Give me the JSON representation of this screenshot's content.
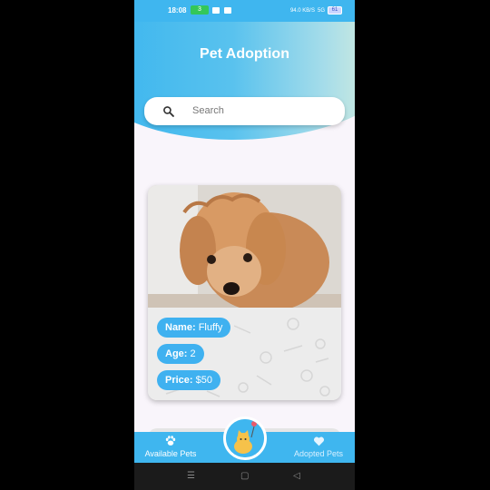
{
  "status": {
    "time": "18:08",
    "badge": "3",
    "net": "94.0 KB/S",
    "signal": "5G",
    "battery": "61"
  },
  "header": {
    "title": "Pet Adoption"
  },
  "search": {
    "placeholder": "Search"
  },
  "pet": {
    "name_label": "Name:",
    "name": "Fluffy",
    "age_label": "Age:",
    "age": "2",
    "price_label": "Price:",
    "price": "$50"
  },
  "nav": {
    "available": "Available Pets",
    "adopted": "Adopted Pets"
  },
  "system_nav": {
    "recents": "☰",
    "home": "▢",
    "back": "◁"
  },
  "colors": {
    "primary": "#3fb6ef",
    "pill": "#3fb1f0"
  }
}
